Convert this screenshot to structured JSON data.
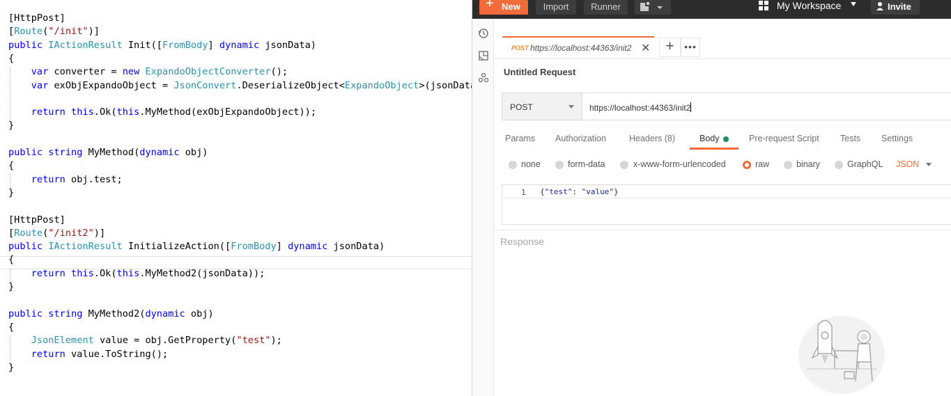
{
  "editor": {
    "lines": [
      [
        [
          "[HttpPost]",
          "tok-plain"
        ]
      ],
      [
        [
          "[",
          "tok-plain"
        ],
        [
          "Route",
          "tok-type"
        ],
        [
          "(",
          "tok-plain"
        ],
        [
          "\"/init\"",
          "tok-str"
        ],
        [
          ")]",
          "tok-plain"
        ]
      ],
      [
        [
          "public ",
          "tok-kw"
        ],
        [
          "IActionResult ",
          "tok-type"
        ],
        [
          "Init([",
          "tok-plain"
        ],
        [
          "FromBody",
          "tok-type"
        ],
        [
          "] ",
          "tok-plain"
        ],
        [
          "dynamic ",
          "tok-kw"
        ],
        [
          "jsonData)",
          "tok-plain"
        ]
      ],
      [
        [
          "{",
          "tok-plain"
        ]
      ],
      [
        [
          "    ",
          "tok-plain"
        ],
        [
          "var ",
          "tok-kw"
        ],
        [
          "converter = ",
          "tok-plain"
        ],
        [
          "new ",
          "tok-kw"
        ],
        [
          "ExpandoObjectConverter",
          "tok-type"
        ],
        [
          "();",
          "tok-plain"
        ]
      ],
      [
        [
          "    ",
          "tok-plain"
        ],
        [
          "var ",
          "tok-kw"
        ],
        [
          "exObjExpandoObject = ",
          "tok-plain"
        ],
        [
          "JsonConvert",
          "tok-type"
        ],
        [
          ".DeserializeObject<",
          "tok-plain"
        ],
        [
          "ExpandoObject",
          "tok-type"
        ],
        [
          ">(jsonData",
          "tok-plain"
        ]
      ],
      [],
      [
        [
          "    ",
          "tok-plain"
        ],
        [
          "return ",
          "tok-kw"
        ],
        [
          "this",
          "tok-kw"
        ],
        [
          ".Ok(",
          "tok-plain"
        ],
        [
          "this",
          "tok-kw"
        ],
        [
          ".MyMethod(exObjExpandoObject));",
          "tok-plain"
        ]
      ],
      [
        [
          "}",
          "tok-plain"
        ]
      ],
      [],
      [
        [
          "public ",
          "tok-kw"
        ],
        [
          "string ",
          "tok-kw"
        ],
        [
          "MyMethod(",
          "tok-plain"
        ],
        [
          "dynamic ",
          "tok-kw"
        ],
        [
          "obj)",
          "tok-plain"
        ]
      ],
      [
        [
          "{",
          "tok-plain"
        ]
      ],
      [
        [
          "    ",
          "tok-plain"
        ],
        [
          "return ",
          "tok-kw"
        ],
        [
          "obj.test;",
          "tok-plain"
        ]
      ],
      [
        [
          "}",
          "tok-plain"
        ]
      ],
      [],
      [
        [
          "[HttpPost]",
          "tok-plain"
        ]
      ],
      [
        [
          "[",
          "tok-plain"
        ],
        [
          "Route",
          "tok-type"
        ],
        [
          "(",
          "tok-plain"
        ],
        [
          "\"/init2\"",
          "tok-str"
        ],
        [
          ")]",
          "tok-plain"
        ]
      ],
      [
        [
          "public ",
          "tok-kw"
        ],
        [
          "IActionResult ",
          "tok-type"
        ],
        [
          "InitializeAction([",
          "tok-plain"
        ],
        [
          "FromBody",
          "tok-type"
        ],
        [
          "] ",
          "tok-plain"
        ],
        [
          "dynamic ",
          "tok-kw"
        ],
        [
          "jsonData)",
          "tok-plain"
        ]
      ],
      [
        [
          "{",
          "tok-plain"
        ]
      ],
      [
        [
          "    ",
          "tok-plain"
        ],
        [
          "return ",
          "tok-kw"
        ],
        [
          "this",
          "tok-kw"
        ],
        [
          ".Ok(",
          "tok-plain"
        ],
        [
          "this",
          "tok-kw"
        ],
        [
          ".MyMethod2(jsonData));",
          "tok-plain"
        ]
      ],
      [
        [
          "}",
          "tok-plain"
        ]
      ],
      [],
      [
        [
          "public ",
          "tok-kw"
        ],
        [
          "string ",
          "tok-kw"
        ],
        [
          "MyMethod2(",
          "tok-plain"
        ],
        [
          "dynamic ",
          "tok-kw"
        ],
        [
          "obj)",
          "tok-plain"
        ]
      ],
      [
        [
          "{",
          "tok-plain"
        ]
      ],
      [
        [
          "    ",
          "tok-plain"
        ],
        [
          "JsonElement ",
          "tok-type"
        ],
        [
          "value = obj.GetProperty(",
          "tok-plain"
        ],
        [
          "\"test\"",
          "tok-str"
        ],
        [
          ");",
          "tok-plain"
        ]
      ],
      [
        [
          "    ",
          "tok-plain"
        ],
        [
          "return ",
          "tok-kw"
        ],
        [
          "value.ToString();",
          "tok-plain"
        ]
      ],
      [
        [
          "}",
          "tok-plain"
        ]
      ]
    ]
  },
  "topbar": {
    "new_label": "New",
    "import_label": "Import",
    "runner_label": "Runner",
    "workspace_label": "My Workspace",
    "invite_label": "Invite"
  },
  "tab": {
    "method": "POST",
    "url": "https://localhost:44363/init2"
  },
  "request": {
    "title": "Untitled Request",
    "method": "POST",
    "url": "https://localhost:44363/init2"
  },
  "request_tabs": {
    "params": "Params",
    "authorization": "Authorization",
    "headers": "Headers (8)",
    "body": "Body",
    "prerequest": "Pre-request Script",
    "tests": "Tests",
    "settings": "Settings"
  },
  "body_types": {
    "none": "none",
    "form_data": "form-data",
    "urlencoded": "x-www-form-urlencoded",
    "raw": "raw",
    "binary": "binary",
    "graphql": "GraphQL",
    "format": "JSON"
  },
  "body_editor": {
    "line_number": "1",
    "open_brace": "{",
    "key": "\"test\"",
    "colon": ": ",
    "value": "\"value\"",
    "close_brace": "}"
  },
  "response": {
    "label": "Response"
  },
  "colors": {
    "accent": "#f26b3a",
    "body_dot": "#268a63",
    "keyword": "#0000ff",
    "type": "#2b91af",
    "string": "#a31515"
  },
  "icons": [
    "history-icon",
    "collections-icon",
    "apis-icon",
    "new-window-icon",
    "workspace-grid-icon",
    "invite-user-icon",
    "text-cursor-icon",
    "rocket-astronaut-illustration"
  ]
}
